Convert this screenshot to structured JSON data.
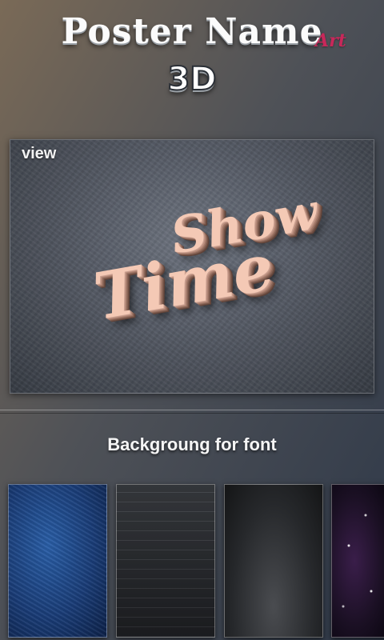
{
  "header": {
    "title": "Poster Name",
    "title_badge": "Art",
    "subtitle": "3D"
  },
  "preview": {
    "label": "view",
    "poster_line_1": "Show",
    "poster_line_2": "Time"
  },
  "backgrounds": {
    "section_title": "Backgroung for font",
    "items": [
      {
        "name": "blue-grunge"
      },
      {
        "name": "dark-wood"
      },
      {
        "name": "dark-gradient"
      },
      {
        "name": "purple-space"
      }
    ]
  },
  "colors": {
    "badge": "#c8285a",
    "poster_text": "#f4c9b5"
  }
}
